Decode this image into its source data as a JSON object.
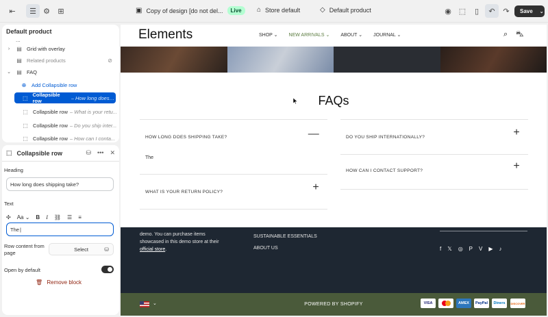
{
  "topbar": {
    "theme_name": "Copy of design [do not del...",
    "live_badge": "Live",
    "store": "Store default",
    "product": "Default product",
    "save_label": "Save"
  },
  "sections": {
    "title": "Default product",
    "ellipsis": "...",
    "items": [
      {
        "label": "Grid with overlay"
      },
      {
        "label": "Related products"
      },
      {
        "label": "FAQ"
      }
    ],
    "add_label": "Add Collapsible row",
    "rows": [
      {
        "label": "Collapsible row",
        "sub": "– How long does s..."
      },
      {
        "label": "Collapsible row",
        "sub": "– What is your retu..."
      },
      {
        "label": "Collapsible row",
        "sub": "– Do you ship inter..."
      },
      {
        "label": "Collapsible row",
        "sub": "– How can I conta..."
      }
    ]
  },
  "block": {
    "title": "Collapsible row",
    "heading_label": "Heading",
    "heading_value": "How long does shipping take?",
    "text_label": "Text",
    "text_value": "The",
    "row_content_label": "Row content from page",
    "select_label": "Select",
    "open_default_label": "Open by default",
    "remove_label": "Remove block"
  },
  "store": {
    "logo": "Elements",
    "nav": [
      "SHOP",
      "NEW ARRIVALS",
      "ABOUT",
      "JOURNAL"
    ],
    "faq_title": "FAQs",
    "faqs": [
      {
        "q": "HOW LONG DOES SHIPPING TAKE?",
        "a": "The"
      },
      {
        "q": "WHAT IS YOUR RETURN POLICY?"
      },
      {
        "q": "DO YOU SHIP INTERNATIONALLY?"
      },
      {
        "q": "HOW CAN I CONTACT SUPPORT?"
      }
    ],
    "footer_text": "demo. You can purchase items showcased in this demo store at their",
    "footer_link": "official store",
    "footer_links": [
      "SUSTAINABLE ESSENTIALS",
      "ABOUT US"
    ],
    "powered": "POWERED BY SHOPIFY",
    "payments": [
      "VISA",
      "MC",
      "AMEX",
      "PayPal",
      "Diners",
      "DISCOVER"
    ]
  },
  "colors": {
    "accent": "#005bd3",
    "footer_bg": "#1e2732",
    "bottom_bar_bg": "#4a5a3a"
  }
}
